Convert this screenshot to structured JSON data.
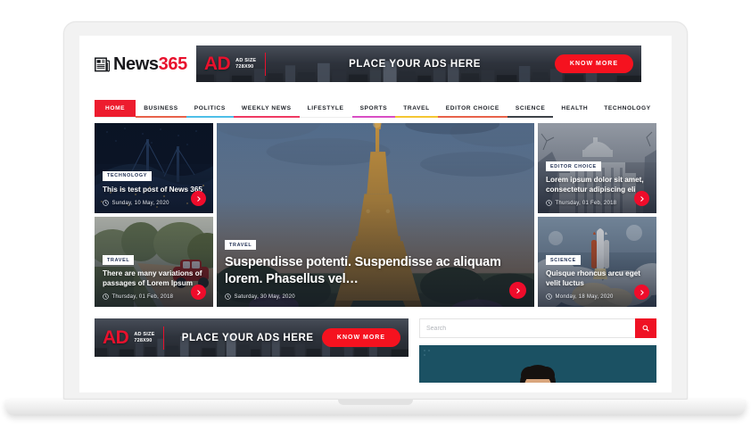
{
  "site": {
    "logo_text_primary": "News",
    "logo_text_accent": "365",
    "logo_icon": "newspaper-icon"
  },
  "ads": {
    "top": {
      "word": "AD",
      "size_line1": "AD SIZE",
      "size_line2": "728X90",
      "headline": "PLACE YOUR ADS HERE",
      "cta": "KNOW MORE"
    },
    "bottom": {
      "word": "AD",
      "size_line1": "AD SIZE",
      "size_line2": "728X90",
      "headline": "PLACE YOUR ADS HERE",
      "cta": "KNOW MORE"
    }
  },
  "nav": {
    "items": [
      {
        "label": "HOME",
        "color": "#ed1c2e",
        "active": true
      },
      {
        "label": "BUSINESS",
        "color": "#e8624a",
        "active": false
      },
      {
        "label": "POLITICS",
        "color": "#4ebfe8",
        "active": false
      },
      {
        "label": "WEEKLY NEWS",
        "color": "#ef3a63",
        "active": false
      },
      {
        "label": "LIFESTYLE",
        "color": "#9ac councils",
        "active": false
      },
      {
        "label": "SPORTS",
        "color": "#d94ec4",
        "active": false
      },
      {
        "label": "TRAVEL",
        "color": "#f5c633",
        "active": false
      },
      {
        "label": "EDITOR CHOICE",
        "color": "#e8624a",
        "active": false
      },
      {
        "label": "SCIENCE",
        "color": "#3d4248",
        "active": false
      },
      {
        "label": "HEALTH",
        "color": "#ffffff",
        "active": false
      },
      {
        "label": "TECHNOLOGY",
        "color": "#ffffff",
        "active": false
      }
    ]
  },
  "hero": {
    "left": [
      {
        "badge": "TECHNOLOGY",
        "title": "This is test post of News 365",
        "date": "Sunday, 10 May, 2020",
        "image": "night-city-bridge-aerial"
      },
      {
        "badge": "TRAVEL",
        "title": "There are many variations of passages of Lorem Ipsum",
        "date": "Thursday, 01 Feb, 2018",
        "image": "vintage-car-dirt-road"
      }
    ],
    "center": {
      "badge": "TRAVEL",
      "title": "Suspendisse potenti. Suspendisse ac aliquam lorem. Phasellus vel…",
      "date": "Saturday, 30 May, 2020",
      "image": "eiffel-tower-paris"
    },
    "right": [
      {
        "badge": "EDITOR CHOICE",
        "title": "Lorem ipsum dolor sit amet, consectetur adipiscing eli",
        "date": "Thursday, 01 Feb, 2018",
        "image": "capitol-building"
      },
      {
        "badge": "SCIENCE",
        "title": "Quisque rhoncus arcu eget velit luctus",
        "date": "Monday, 18 May, 2020",
        "image": "space-shuttle-launch"
      }
    ]
  },
  "sidebar": {
    "search_placeholder": "Search",
    "search_value": "",
    "search_icon": "search-icon"
  },
  "colors": {
    "brand_red": "#ed1c2e",
    "accent_red": "#ef0c2b",
    "badge_text": "#1d2d52",
    "video_panel": "#1b5163"
  }
}
